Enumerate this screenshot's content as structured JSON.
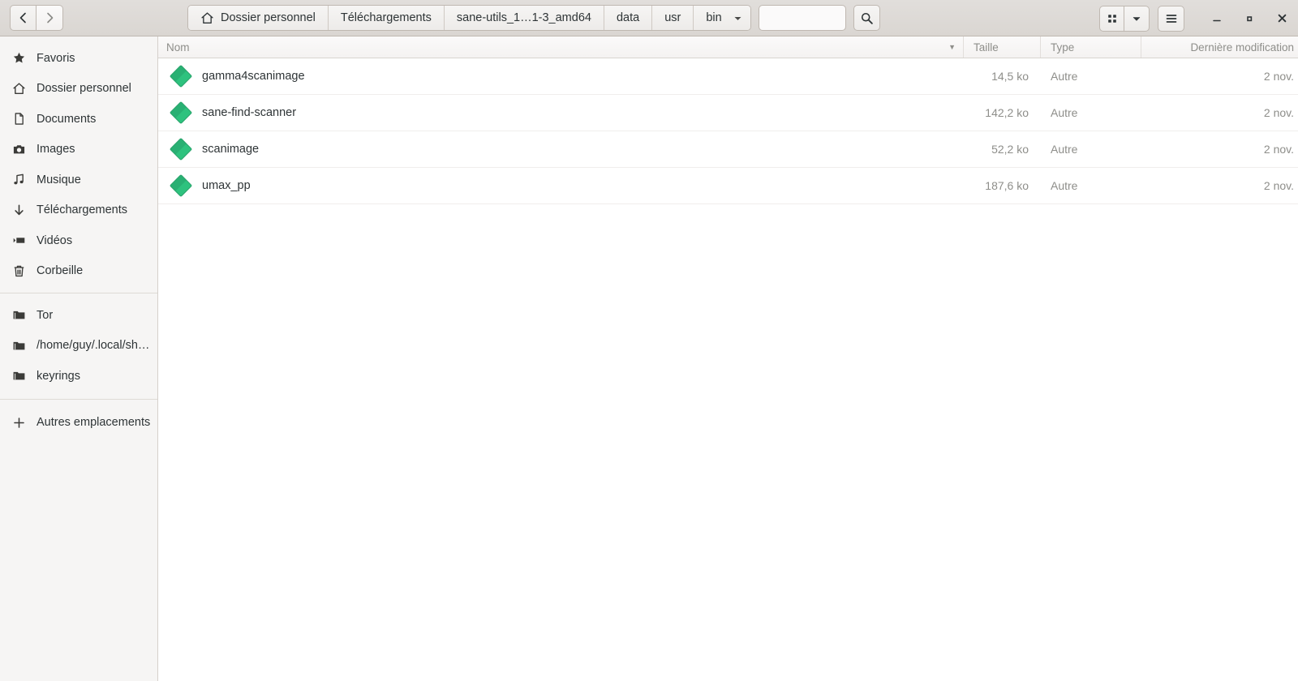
{
  "header": {
    "nav": {
      "back_label": "‹",
      "forward_label": "›"
    },
    "breadcrumbs": [
      {
        "label": "Dossier personnel",
        "icon": "home-icon"
      },
      {
        "label": "Téléchargements",
        "icon": ""
      },
      {
        "label": "sane-utils_1…1-3_amd64",
        "icon": ""
      },
      {
        "label": "data",
        "icon": ""
      },
      {
        "label": "usr",
        "icon": ""
      },
      {
        "label": "bin",
        "icon": "chevron-down-icon"
      }
    ],
    "search": {
      "value": "",
      "placeholder": ""
    },
    "buttons": {
      "search_icon": "search-icon",
      "grid_view_icon": "grid-view-icon",
      "view_dropdown_icon": "chevron-down-icon",
      "menu_icon": "hamburger-menu-icon"
    },
    "window_controls": {
      "minimize": "–",
      "maximize": "□",
      "close": "✕"
    }
  },
  "sidebar": {
    "groups": [
      {
        "items": [
          {
            "label": "Favoris",
            "icon": "star-icon"
          },
          {
            "label": "Dossier personnel",
            "icon": "home-icon"
          },
          {
            "label": "Documents",
            "icon": "document-icon"
          },
          {
            "label": "Images",
            "icon": "camera-icon"
          },
          {
            "label": "Musique",
            "icon": "music-note-icon"
          },
          {
            "label": "Téléchargements",
            "icon": "download-arrow-icon"
          },
          {
            "label": "Vidéos",
            "icon": "video-icon"
          },
          {
            "label": "Corbeille",
            "icon": "trash-icon"
          }
        ]
      },
      {
        "items": [
          {
            "label": "Tor",
            "icon": "folder-icon"
          },
          {
            "label": "/home/guy/.local/sh…",
            "icon": "folder-icon"
          },
          {
            "label": "keyrings",
            "icon": "folder-icon"
          }
        ]
      },
      {
        "items": [
          {
            "label": "Autres emplacements",
            "icon": "plus-icon"
          }
        ]
      }
    ]
  },
  "filelist": {
    "columns": {
      "name": "Nom",
      "size": "Taille",
      "type": "Type",
      "modified": "Dernière modification"
    },
    "sort_indicator": "▼",
    "rows": [
      {
        "icon": "executable-binary-icon",
        "name": "gamma4scanimage",
        "size": "14,5 ko",
        "type": "Autre",
        "modified": "2 nov."
      },
      {
        "icon": "executable-binary-icon",
        "name": "sane-find-scanner",
        "size": "142,2 ko",
        "type": "Autre",
        "modified": "2 nov."
      },
      {
        "icon": "executable-binary-icon",
        "name": "scanimage",
        "size": "52,2 ko",
        "type": "Autre",
        "modified": "2 nov."
      },
      {
        "icon": "executable-binary-icon",
        "name": "umax_pp",
        "size": "187,6 ko",
        "type": "Autre",
        "modified": "2 nov."
      }
    ]
  },
  "colors": {
    "headerbar": "#dad6d2",
    "sidebar": "#f6f5f4",
    "accent_icon_green": "#2ec27e",
    "accent_icon_green_dark": "#26a269",
    "text": "#2e3436",
    "text_dim": "#8e8e8a"
  }
}
